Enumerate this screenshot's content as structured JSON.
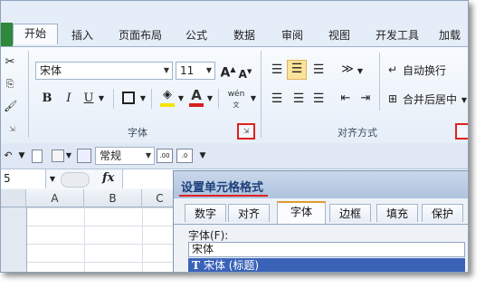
{
  "tabs": [
    "开始",
    "插入",
    "页面布局",
    "公式",
    "数据",
    "审阅",
    "视图",
    "开发工具",
    "加载"
  ],
  "ribbon": {
    "font_name": "宋体",
    "font_size": "11",
    "grow_font": "A",
    "shrink_font": "A",
    "bold": "B",
    "italic": "I",
    "underline": "U",
    "phonetic": "wén",
    "wrap_text": "自动换行",
    "merge_center": "合并后居中",
    "font_group_label": "字体",
    "align_group_label": "对齐方式"
  },
  "qat": {
    "number_format": "常规"
  },
  "formula_bar": {
    "name_box": "5",
    "fx": "fx"
  },
  "grid": {
    "columns": [
      "A",
      "B",
      "C"
    ]
  },
  "dialog": {
    "title": "设置单元格格式",
    "tabs": [
      "数字",
      "对齐",
      "字体",
      "边框",
      "填充",
      "保护"
    ],
    "active_tab": "字体",
    "font_label": "字体(F):",
    "font_value": "宋体",
    "font_list_item": "宋体 (标题)"
  },
  "colors": {
    "accent_red": "#e02020",
    "selection_blue": "#3a63b8",
    "excel_green": "#2e8a3a"
  }
}
